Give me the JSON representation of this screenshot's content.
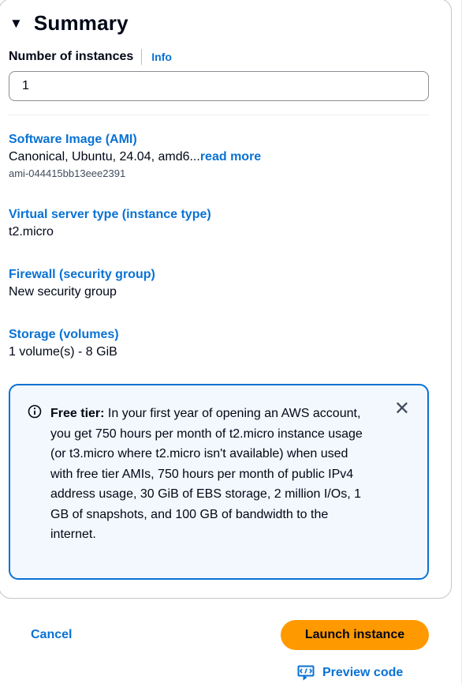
{
  "summary": {
    "title": "Summary",
    "caret": "▼"
  },
  "instances": {
    "label": "Number of instances",
    "info": "Info",
    "value": "1"
  },
  "ami": {
    "title": "Software Image (AMI)",
    "value": "Canonical, Ubuntu, 24.04, amd6...",
    "read_more": "read more",
    "id": "ami-044415bb13eee2391"
  },
  "instance_type": {
    "title": "Virtual server type (instance type)",
    "value": "t2.micro"
  },
  "firewall": {
    "title": "Firewall (security group)",
    "value": "New security group"
  },
  "storage": {
    "title": "Storage (volumes)",
    "value": "1 volume(s) - 8 GiB"
  },
  "free_tier": {
    "label": "Free tier:",
    "text": " In your first year of opening an AWS account, you get 750 hours per month of t2.micro instance usage (or t3.micro where t2.micro isn't available) when used with free tier AMIs, 750 hours per month of public IPv4 address usage, 30 GiB of EBS storage, 2 million I/Os, 1 GB of snapshots, and 100 GB of bandwidth to the internet.",
    "close": "✕"
  },
  "actions": {
    "cancel": "Cancel",
    "launch": "Launch instance",
    "preview": "Preview code"
  },
  "colors": {
    "link": "#0972d3",
    "primary_button": "#ff9900",
    "info_bg": "#f2f8fd"
  }
}
